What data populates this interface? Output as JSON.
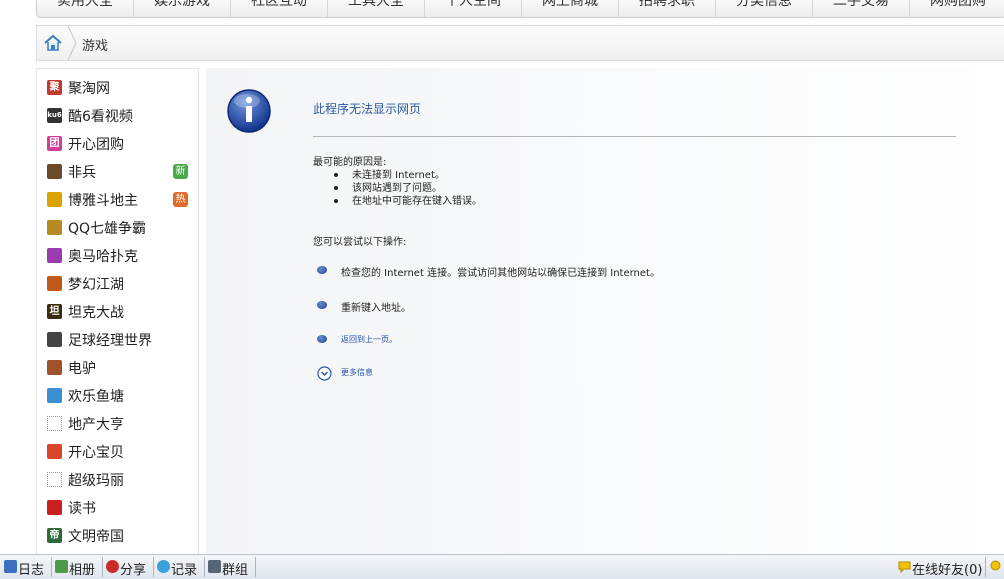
{
  "top_nav": [
    "实用大全",
    "娱乐游戏",
    "社区互动",
    "工具大全",
    "个人空间",
    "网上商城",
    "招聘求职",
    "分类信息",
    "二手交易",
    "网购团购"
  ],
  "breadcrumb": {
    "current": "游戏"
  },
  "sidebar": {
    "items": [
      {
        "label": "聚淘网",
        "icon": "jutao-logo-icon",
        "glyph": "聚",
        "color": "#c0392b"
      },
      {
        "label": "酷6看视频",
        "icon": "ku6-logo-icon",
        "glyph": "ku6",
        "color": "#333333"
      },
      {
        "label": "开心团购",
        "icon": "tuan-icon",
        "glyph": "团",
        "color": "#d0409a"
      },
      {
        "label": "非兵",
        "icon": "shield-game-icon",
        "glyph": "",
        "color": "#6b4a2a",
        "badge": "新",
        "badge_color": "#4aa94a"
      },
      {
        "label": "博雅斗地主",
        "icon": "cards-game-icon",
        "glyph": "",
        "color": "#d9a300",
        "badge": "热",
        "badge_color": "#e06a2c"
      },
      {
        "label": "QQ七雄争霸",
        "icon": "sword-game-icon",
        "glyph": "",
        "color": "#b58a22"
      },
      {
        "label": "奥马哈扑克",
        "icon": "poker-game-icon",
        "glyph": "",
        "color": "#9b3bb0"
      },
      {
        "label": "梦幻江湖",
        "icon": "fantasy-game-icon",
        "glyph": "",
        "color": "#c05a1a"
      },
      {
        "label": "坦克大战",
        "icon": "tank-game-icon",
        "glyph": "坦",
        "color": "#3a2a12"
      },
      {
        "label": "足球经理世界",
        "icon": "football-icon",
        "glyph": "",
        "color": "#444444"
      },
      {
        "label": "电驴",
        "icon": "donkey-icon",
        "glyph": "",
        "color": "#a0522d"
      },
      {
        "label": "欢乐鱼塘",
        "icon": "fish-pond-icon",
        "glyph": "",
        "color": "#3a8fd0"
      },
      {
        "label": "地产大亨",
        "icon": "placeholder-icon",
        "glyph": "",
        "color": ""
      },
      {
        "label": "开心宝贝",
        "icon": "baby-icon",
        "glyph": "",
        "color": "#d9462a"
      },
      {
        "label": "超级玛丽",
        "icon": "placeholder-icon",
        "glyph": "",
        "color": ""
      },
      {
        "label": "读书",
        "icon": "book-icon",
        "glyph": "",
        "color": "#cc1f1f"
      },
      {
        "label": "文明帝国",
        "icon": "empire-icon",
        "glyph": "帝",
        "color": "#2f6b3a"
      }
    ]
  },
  "error_page": {
    "title": "此程序无法显示网页",
    "reasons_heading": "最可能的原因是:",
    "reasons": [
      "未连接到 Internet。",
      "该网站遇到了问题。",
      "在地址中可能存在键入错误。"
    ],
    "actions_heading": "您可以尝试以下操作:",
    "actions": [
      {
        "text": "检查您的 Internet 连接。尝试访问其他网站以确保已连接到 Internet。",
        "link": false
      },
      {
        "text": "重新键入地址。",
        "link": false
      },
      {
        "text": "返回到上一页。",
        "link": true
      }
    ],
    "more_info": "更多信息"
  },
  "bottom_bar": {
    "items": [
      {
        "label": "日志",
        "icon": "diary-icon"
      },
      {
        "label": "相册",
        "icon": "album-icon"
      },
      {
        "label": "分享",
        "icon": "share-heart-icon"
      },
      {
        "label": "记录",
        "icon": "chat-bubble-icon"
      },
      {
        "label": "群组",
        "icon": "group-icon"
      }
    ],
    "online_friends": "在线好友(0)"
  }
}
